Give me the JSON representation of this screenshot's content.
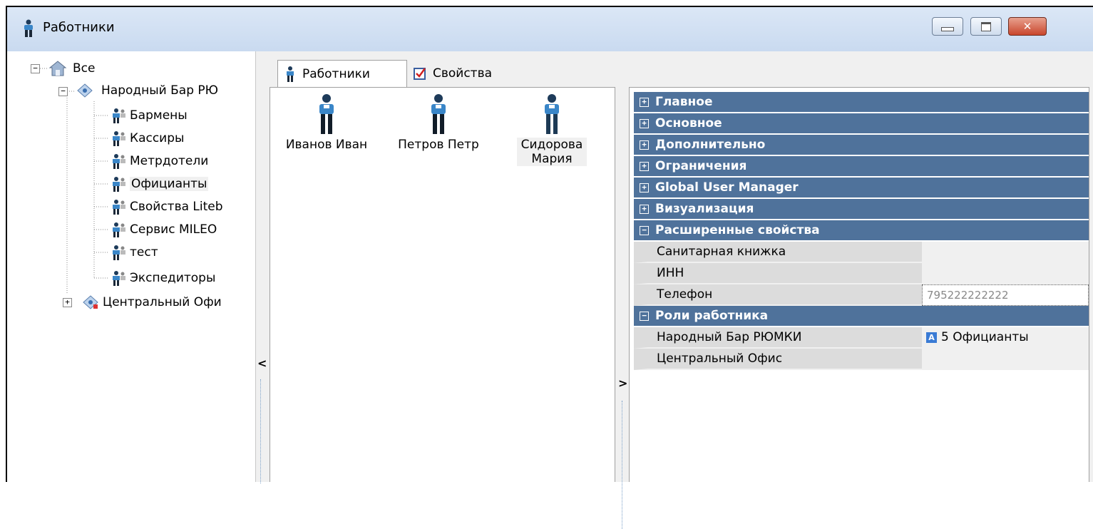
{
  "window": {
    "title": "Работники",
    "minimize_glyph": "▭",
    "maximize_glyph": "▢",
    "close_glyph": "✕"
  },
  "tree": {
    "root": "Все",
    "sites": [
      {
        "label": "Народный Бар РЮ",
        "expanded": true,
        "groups": [
          "Бармены",
          "Кассиры",
          "Метрдотели",
          "Официанты",
          "Свойства Liteb",
          "Сервис MILEO",
          "тест",
          "Экспедиторы"
        ]
      },
      {
        "label": "Центральный Офи",
        "expanded": false
      }
    ],
    "selected_group": "Официанты"
  },
  "tabs": [
    {
      "label": "Работники",
      "icon": "worker-icon",
      "active": true
    },
    {
      "label": "Свойства",
      "icon": "checkbox-icon",
      "active": false
    }
  ],
  "employees": [
    {
      "name": "Иванов Иван"
    },
    {
      "name": "Петров Петр"
    },
    {
      "name_line1": "Сидорова",
      "name_line2": "Мария",
      "selected": true
    }
  ],
  "properties": {
    "categories": [
      {
        "label": "Главное",
        "expanded": false
      },
      {
        "label": "Основное",
        "expanded": false
      },
      {
        "label": "Дополнительно",
        "expanded": false
      },
      {
        "label": "Ограничения",
        "expanded": false
      },
      {
        "label": "Global User Manager",
        "expanded": false
      },
      {
        "label": "Визуализация",
        "expanded": false
      },
      {
        "label": "Расширенные свойства",
        "expanded": true
      }
    ],
    "extended_items": [
      {
        "name": "Санитарная книжка",
        "value": ""
      },
      {
        "name": "ИНН",
        "value": ""
      },
      {
        "name": "Телефон",
        "value": "795222222222"
      }
    ],
    "roles_category": "Роли работника",
    "roles_items": [
      {
        "name": "Народный Бар РЮМКИ",
        "value": "5 Официанты",
        "icon": "role-icon",
        "icon_text": "A"
      },
      {
        "name": "Центральный Офис",
        "value": ""
      }
    ]
  },
  "splitters": {
    "left_arrow": "<",
    "right_arrow": ">"
  },
  "expander_glyphs": {
    "collapsed": "+",
    "expanded": "−"
  },
  "colors": {
    "category_bg": "#4f729b",
    "title_bar": "#c9daf0"
  }
}
